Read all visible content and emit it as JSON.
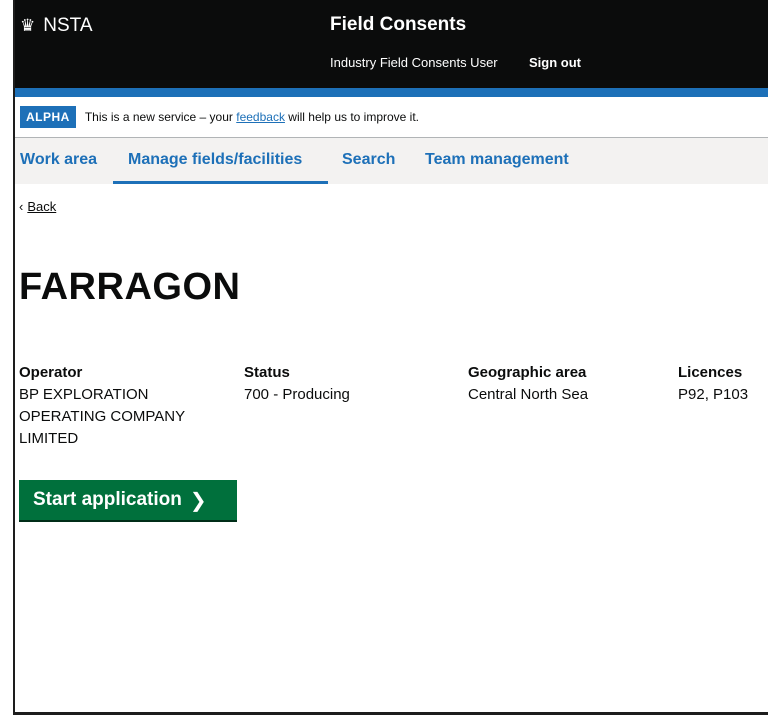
{
  "header": {
    "logo_icon": "crown-icon",
    "logo_text": "NSTA",
    "service_title": "Field Consents",
    "user_label": "Industry Field Consents User",
    "sign_out": "Sign out"
  },
  "phase_banner": {
    "tag": "ALPHA",
    "text_before": "This is a new service – your",
    "link": "feedback",
    "text_after": "will help us to improve it."
  },
  "nav": {
    "items": [
      {
        "label": "Work area",
        "active": false
      },
      {
        "label": "Manage fields/facilities",
        "active": true
      },
      {
        "label": "Search",
        "active": false
      },
      {
        "label": "Team management",
        "active": false
      }
    ]
  },
  "back": {
    "icon": "chevron-left-icon",
    "label": "Back"
  },
  "page_title": "FARRAGON",
  "details": [
    {
      "label": "Operator",
      "value": "BP EXPLORATION OPERATING COMPANY LIMITED"
    },
    {
      "label": "Status",
      "value": "700 - Producing"
    },
    {
      "label": "Geographic area",
      "value": "Central North Sea"
    },
    {
      "label": "Licences",
      "value": "P92, P103"
    }
  ],
  "start_button": {
    "label": "Start application",
    "icon": "chevron-right-icon"
  },
  "colors": {
    "header_bg": "#0b0c0c",
    "brand_blue": "#1d70b8",
    "button_green": "#00703c",
    "nav_bg": "#f3f2f1"
  }
}
